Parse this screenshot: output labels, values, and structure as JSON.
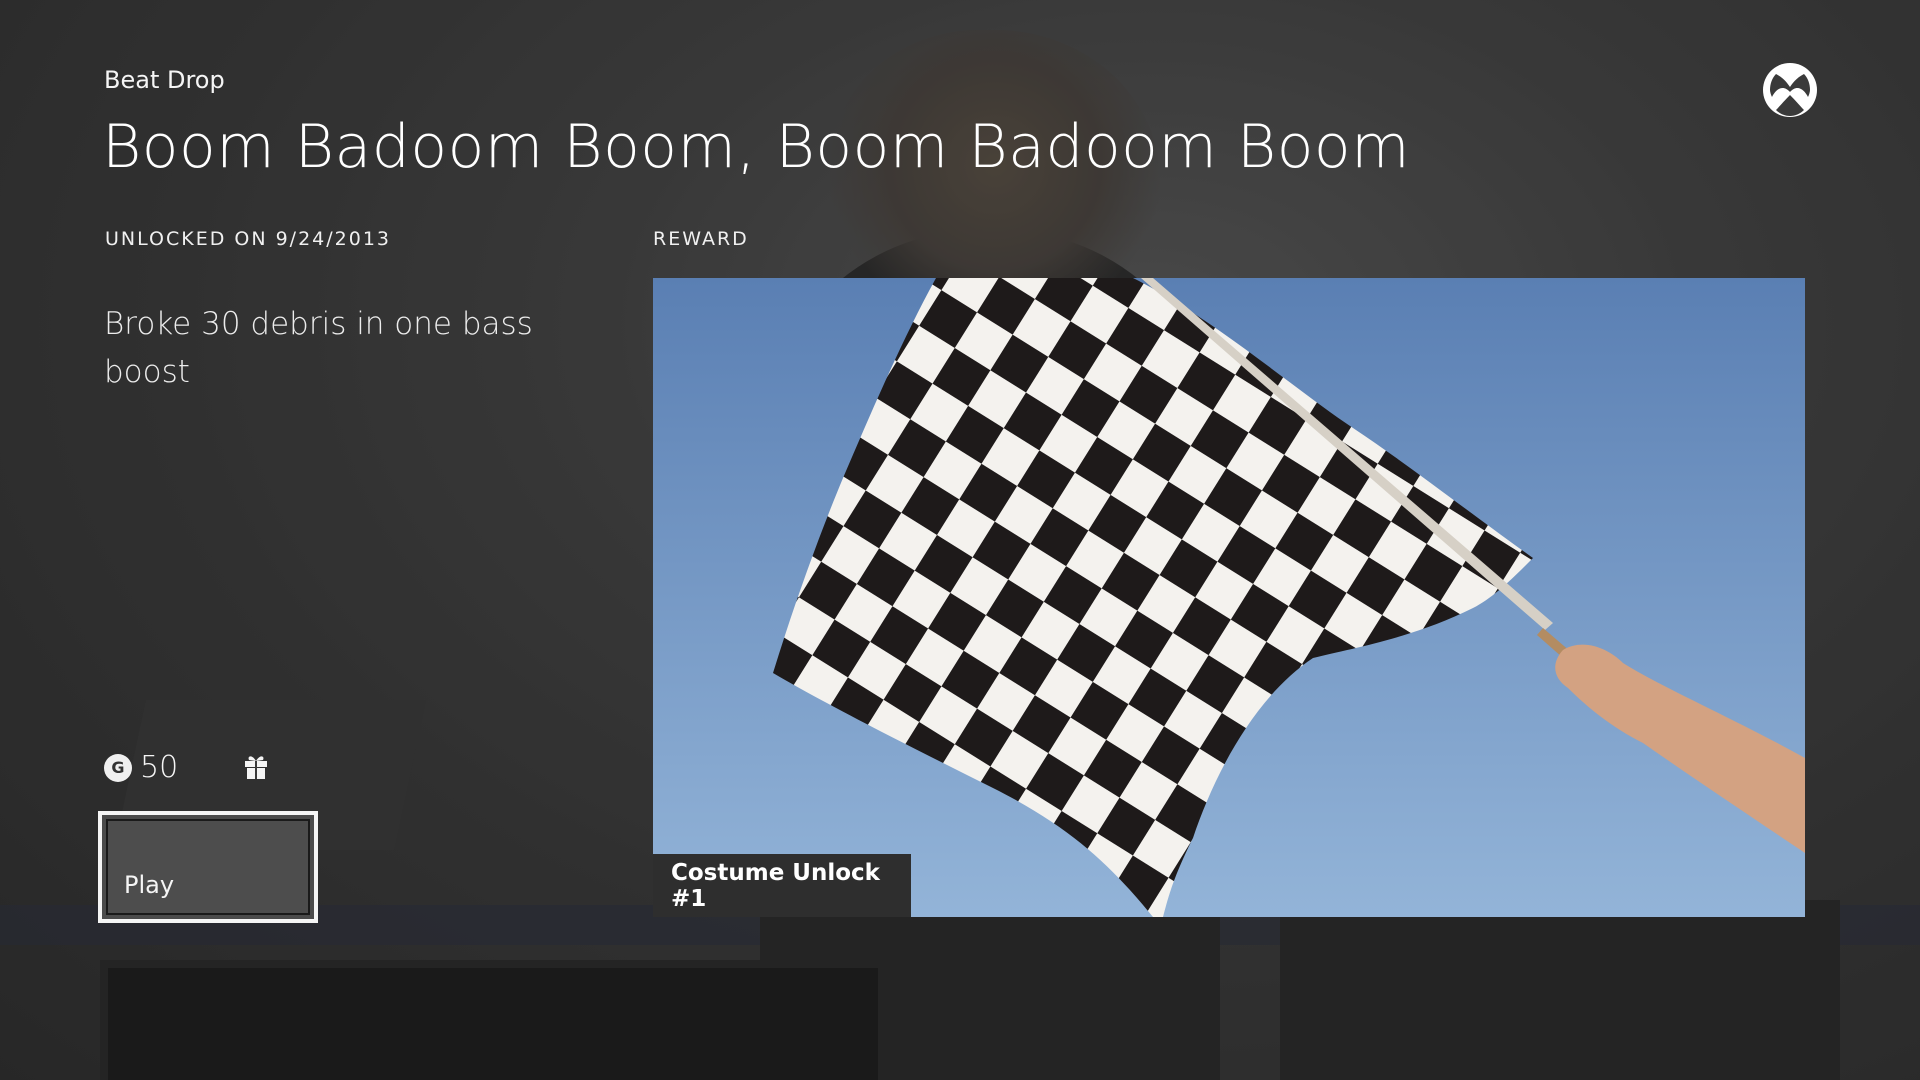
{
  "header": {
    "app_name": "Beat Drop",
    "achievement_title": "Boom Badoom Boom, Boom Badoom Boom"
  },
  "details": {
    "unlocked_label": "UNLOCKED ON 9/24/2013",
    "description": "Broke 30 debris in one bass boost",
    "gamerscore_icon": "G",
    "gamerscore_value": "50"
  },
  "reward": {
    "section_label": "REWARD",
    "caption": "Costume Unlock #1"
  },
  "actions": {
    "play_label": "Play"
  },
  "icons": {
    "logo": "xbox-logo-icon",
    "gamerscore": "gamerscore-icon",
    "reward": "gift-icon"
  },
  "colors": {
    "background": "#3a3a3a",
    "text": "#ffffff",
    "focus_border": "#f5f5f5",
    "sky": "#6a90c1",
    "caption_bg": "#2e2e2e"
  }
}
